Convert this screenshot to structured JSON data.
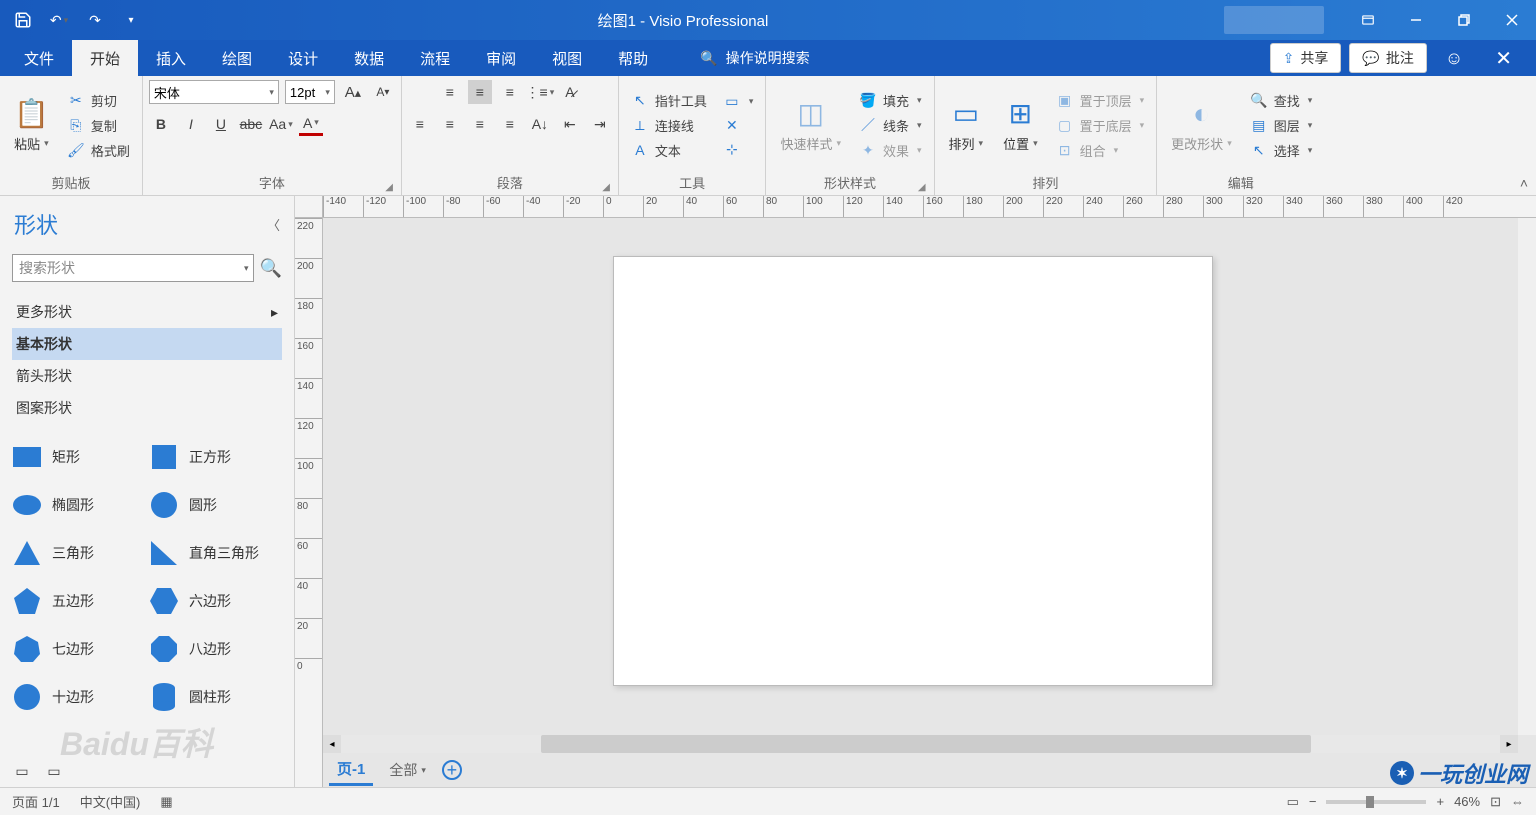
{
  "titlebar": {
    "doc": "绘图1",
    "separator": " - ",
    "app": "Visio Professional"
  },
  "tabs": {
    "file": "文件",
    "home": "开始",
    "insert": "插入",
    "draw": "绘图",
    "design": "设计",
    "data": "数据",
    "process": "流程",
    "review": "审阅",
    "view": "视图",
    "help": "帮助",
    "tellme_placeholder": "操作说明搜索",
    "share": "共享",
    "comments": "批注"
  },
  "ribbon": {
    "clipboard": {
      "label": "剪贴板",
      "paste": "粘贴",
      "cut": "剪切",
      "copy": "复制",
      "format_painter": "格式刷"
    },
    "font": {
      "label": "字体",
      "font_name": "宋体",
      "font_size": "12pt"
    },
    "paragraph": {
      "label": "段落"
    },
    "tools": {
      "label": "工具",
      "pointer": "指针工具",
      "connector": "连接线",
      "text": "文本"
    },
    "shape_styles": {
      "label": "形状样式",
      "quick": "快速样式",
      "fill": "填充",
      "line": "线条",
      "effects": "效果"
    },
    "arrange": {
      "label": "排列",
      "align": "排列",
      "position": "位置",
      "bring_front": "置于顶层",
      "send_back": "置于底层",
      "group": "组合"
    },
    "editing": {
      "label": "编辑",
      "change_shape": "更改形状",
      "find": "查找",
      "layers": "图层",
      "select": "选择"
    }
  },
  "shapes_panel": {
    "title": "形状",
    "search_placeholder": "搜索形状",
    "more": "更多形状",
    "stencils": {
      "basic": "基本形状",
      "arrows": "箭头形状",
      "patterns": "图案形状"
    },
    "shapes": {
      "rectangle": "矩形",
      "square": "正方形",
      "ellipse": "椭圆形",
      "circle": "圆形",
      "triangle": "三角形",
      "right_triangle": "直角三角形",
      "pentagon": "五边形",
      "hexagon": "六边形",
      "heptagon": "七边形",
      "octagon": "八边形",
      "decagon": "十边形",
      "cylinder": "圆柱形"
    }
  },
  "ruler_h": [
    "-140",
    "-120",
    "-100",
    "-80",
    "-60",
    "-40",
    "-20",
    "0",
    "20",
    "40",
    "60",
    "80",
    "100",
    "120",
    "140",
    "160",
    "180",
    "200",
    "220",
    "240",
    "260",
    "280",
    "300",
    "320",
    "340",
    "360",
    "380",
    "400",
    "420"
  ],
  "ruler_v": [
    "220",
    "200",
    "180",
    "160",
    "140",
    "120",
    "100",
    "80",
    "60",
    "40",
    "20",
    "0"
  ],
  "page_tabs": {
    "page1": "页-1",
    "all": "全部"
  },
  "status": {
    "page": "页面 1/1",
    "lang": "中文(中国)",
    "zoom": "46%"
  },
  "watermarks": {
    "bl": "Baidu百科",
    "br": "一玩创业网"
  }
}
